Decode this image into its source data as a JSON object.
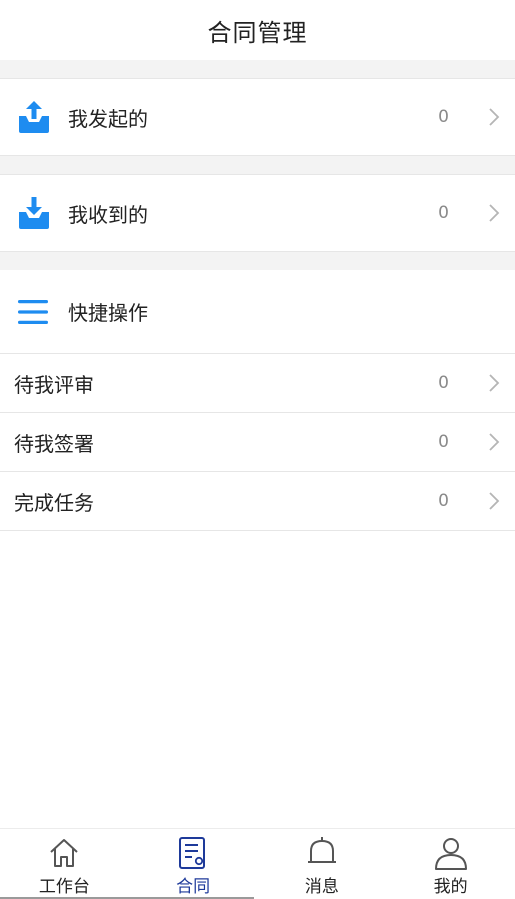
{
  "header": {
    "title": "合同管理"
  },
  "top_rows": [
    {
      "label": "我发起的",
      "count": "0",
      "icon": "upload-tray-icon"
    },
    {
      "label": "我收到的",
      "count": "0",
      "icon": "download-tray-icon"
    }
  ],
  "quick": {
    "title": "快捷操作",
    "icon": "menu-lines-icon",
    "items": [
      {
        "label": "待我评审",
        "count": "0"
      },
      {
        "label": "待我签署",
        "count": "0"
      },
      {
        "label": "完成任务",
        "count": "0"
      }
    ]
  },
  "tabbar": {
    "tabs": [
      {
        "label": "工作台",
        "icon": "home-icon"
      },
      {
        "label": "合同",
        "icon": "contract-document-icon",
        "active": true
      },
      {
        "label": "消息",
        "icon": "bell-icon"
      },
      {
        "label": "我的",
        "icon": "user-icon"
      }
    ]
  },
  "colors": {
    "accent_blue": "#1e8cf0",
    "active_tab": "#1e3a9a",
    "muted": "#8a8a8a",
    "gap_bg": "#f3f3f3"
  }
}
